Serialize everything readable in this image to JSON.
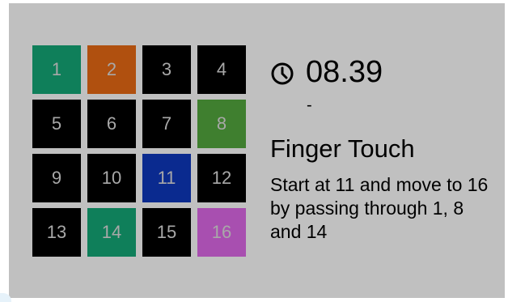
{
  "tiles": [
    {
      "label": "1",
      "color": "#0f7f5a"
    },
    {
      "label": "2",
      "color": "#b0500f"
    },
    {
      "label": "3",
      "color": "#000000"
    },
    {
      "label": "4",
      "color": "#000000"
    },
    {
      "label": "5",
      "color": "#000000"
    },
    {
      "label": "6",
      "color": "#000000"
    },
    {
      "label": "7",
      "color": "#000000"
    },
    {
      "label": "8",
      "color": "#3f7f2f"
    },
    {
      "label": "9",
      "color": "#000000"
    },
    {
      "label": "10",
      "color": "#000000"
    },
    {
      "label": "11",
      "color": "#0a2a8f"
    },
    {
      "label": "12",
      "color": "#000000"
    },
    {
      "label": "13",
      "color": "#000000"
    },
    {
      "label": "14",
      "color": "#0f7f5a"
    },
    {
      "label": "15",
      "color": "#000000"
    },
    {
      "label": "16",
      "color": "#a84fb0"
    }
  ],
  "info": {
    "clock_icon": "clock-icon",
    "timer": "08.39",
    "dash": "-",
    "title": "Finger Touch",
    "instructions": "Start at 11 and move to 16 by passing through 1, 8 and 14"
  },
  "colors": {
    "panel_background": "#c0c0c0",
    "tile_text": "#a8a8a8"
  }
}
